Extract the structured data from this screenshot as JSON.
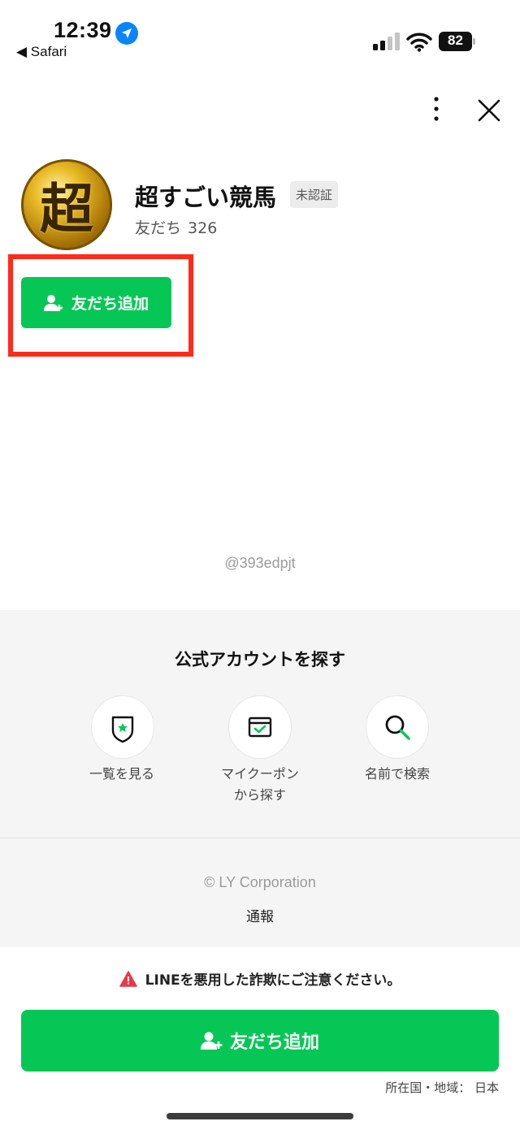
{
  "status_bar": {
    "time": "12:39",
    "back_label": "◀ Safari",
    "battery": "82"
  },
  "profile": {
    "avatar_glyph": "超",
    "name": "超すごい競馬",
    "badge": "未認証",
    "friends_label": "友だち",
    "friends_count": "326",
    "add_friend_label": "友だち追加",
    "handle": "@393edpjt"
  },
  "explore": {
    "title": "公式アカウントを探す",
    "items": [
      {
        "label": "一覧を見る",
        "icon": "shield-star-icon"
      },
      {
        "label": "マイクーポン\nから探す",
        "icon": "coupon-box-icon"
      },
      {
        "label": "名前で検索",
        "icon": "search-icon"
      }
    ]
  },
  "footer": {
    "copyright": "© LY Corporation",
    "report": "通報"
  },
  "bottom": {
    "warning": "LINEを悪用した詐欺にご注意ください。",
    "add_friend_label": "友だち追加",
    "region": "所在国・地域： 日本"
  },
  "colors": {
    "brand_green": "#06c755",
    "highlight_red": "#ff2a1a",
    "warning_red": "#e8394a"
  }
}
